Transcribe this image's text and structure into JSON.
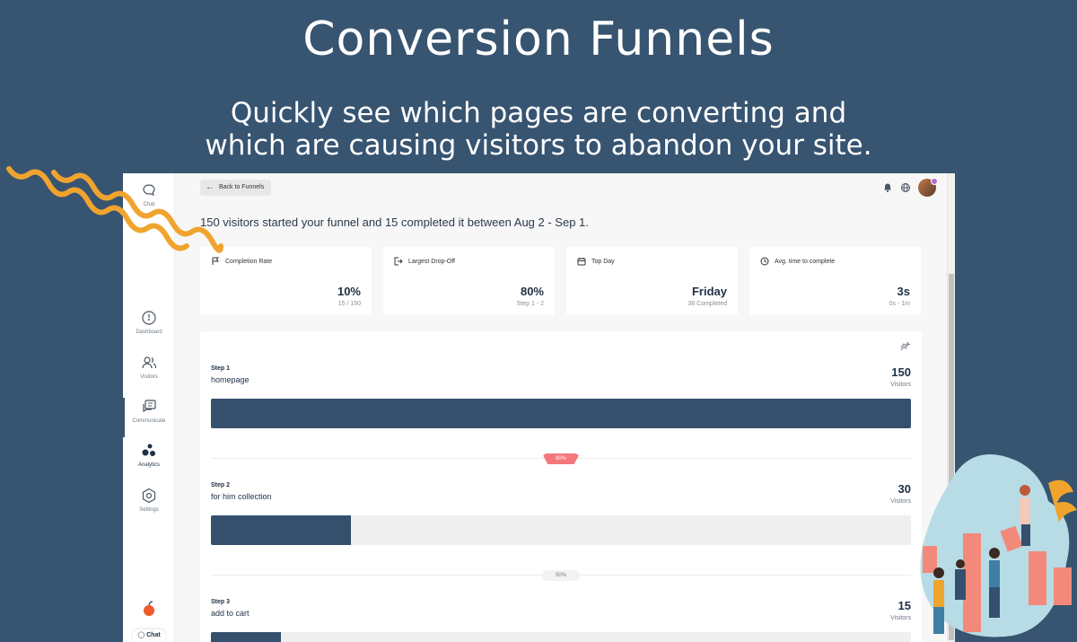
{
  "hero": {
    "title": "Conversion Funnels",
    "subtitle_line1": "Quickly see which pages are converting and",
    "subtitle_line2": "which are causing visitors to abandon your site."
  },
  "sidebar": {
    "items": [
      {
        "label": "Chat",
        "icon": "chat-bubble-icon"
      },
      {
        "label": "Dashboard",
        "icon": "gauge-icon"
      },
      {
        "label": "Visitors",
        "icon": "users-icon"
      },
      {
        "label": "Communicate",
        "icon": "messages-icon"
      },
      {
        "label": "Analytics",
        "icon": "analytics-dots-icon",
        "active": true
      },
      {
        "label": "Settings",
        "icon": "hexagon-gear-icon"
      }
    ],
    "chat_tab": "Chat"
  },
  "header": {
    "back_label": "Back to Funnels"
  },
  "summary": "150 visitors started your funnel and 15 completed it between Aug 2 - Sep 1.",
  "cards": [
    {
      "label": "Completion Rate",
      "icon": "flag-icon",
      "value": "10%",
      "sub": "15 / 150"
    },
    {
      "label": "Largest Drop-Off",
      "icon": "exit-icon",
      "value": "80%",
      "sub": "Step 1 - 2"
    },
    {
      "label": "Top Day",
      "icon": "calendar-icon",
      "value": "Friday",
      "sub": "38 Completed"
    },
    {
      "label": "Avg. time to complete",
      "icon": "clock-icon",
      "value": "3s",
      "sub": "0s - 1m"
    }
  ],
  "steps": [
    {
      "num": "Step 1",
      "name": "homepage",
      "count": "150",
      "unit": "Visitors",
      "fill_fraction": 1.0
    },
    {
      "num": "Step 2",
      "name": "for him collection",
      "count": "30",
      "unit": "Visitors",
      "fill_fraction": 0.2
    },
    {
      "num": "Step 3",
      "name": "add to cart",
      "count": "15",
      "unit": "Visitors",
      "fill_fraction": 0.1
    }
  ],
  "dropoffs": [
    "80%",
    "50%"
  ],
  "colors": {
    "background": "#375471",
    "bar": "#34506d",
    "dropoff_hot": "#f3777c",
    "accent_squiggle": "#f0a42e"
  }
}
